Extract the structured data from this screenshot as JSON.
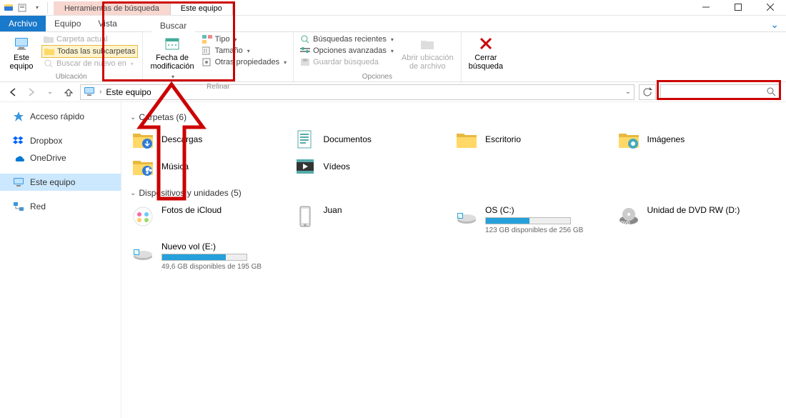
{
  "titlebar": {
    "contextual_label": "Herramientas de búsqueda",
    "title_tab": "Este equipo"
  },
  "ribbon_tabs": {
    "file": "Archivo",
    "equipo": "Equipo",
    "vista": "Vista",
    "buscar": "Buscar"
  },
  "ribbon": {
    "ubicacion": {
      "label": "Ubicación",
      "este_equipo": "Este\nequipo",
      "carpeta_actual": "Carpeta actual",
      "todas_subcarpetas": "Todas las subcarpetas",
      "buscar_de_nuevo": "Buscar de nuevo en"
    },
    "refinar": {
      "label": "Refinar",
      "fecha_mod": "Fecha de\nmodificación",
      "tipo": "Tipo",
      "tamano": "Tamaño",
      "otras_prop": "Otras propiedades"
    },
    "opciones": {
      "label": "Opciones",
      "busq_recientes": "Búsquedas recientes",
      "opc_avanzadas": "Opciones avanzadas",
      "guardar": "Guardar búsqueda",
      "abrir_ubic": "Abrir ubicación\nde archivo"
    },
    "cerrar": "Cerrar\nbúsqueda"
  },
  "addressbar": {
    "path": "Este equipo"
  },
  "search": {
    "placeholder": "",
    "value": ""
  },
  "sidebar": {
    "items": [
      {
        "label": "Acceso rápido",
        "icon": "star"
      },
      {
        "label": "Dropbox",
        "icon": "dropbox"
      },
      {
        "label": "OneDrive",
        "icon": "onedrive"
      },
      {
        "label": "Este equipo",
        "icon": "pc",
        "selected": true
      },
      {
        "label": "Red",
        "icon": "network"
      }
    ]
  },
  "content": {
    "folders_header": "Carpetas (6)",
    "devices_header": "Dispositivos y unidades (5)",
    "folders": [
      {
        "label": "Descargas",
        "kind": "downloads"
      },
      {
        "label": "Documentos",
        "kind": "documents"
      },
      {
        "label": "Escritorio",
        "kind": "folder"
      },
      {
        "label": "Imágenes",
        "kind": "pictures"
      },
      {
        "label": "Música",
        "kind": "music"
      },
      {
        "label": "Vídeos",
        "kind": "videos"
      }
    ],
    "drives": [
      {
        "label": "Fotos de iCloud",
        "kind": "icloud",
        "bar": null,
        "sub": ""
      },
      {
        "label": "Juan",
        "kind": "phone",
        "bar": null,
        "sub": ""
      },
      {
        "label": "OS (C:)",
        "kind": "hdd",
        "bar": 52,
        "sub": "123 GB disponibles de 256 GB"
      },
      {
        "label": "Unidad de DVD RW (D:)",
        "kind": "dvd",
        "bar": null,
        "sub": ""
      },
      {
        "label": "Nuevo vol (E:)",
        "kind": "hdd",
        "bar": 75,
        "sub": "49,6 GB disponibles de 195 GB"
      }
    ]
  }
}
